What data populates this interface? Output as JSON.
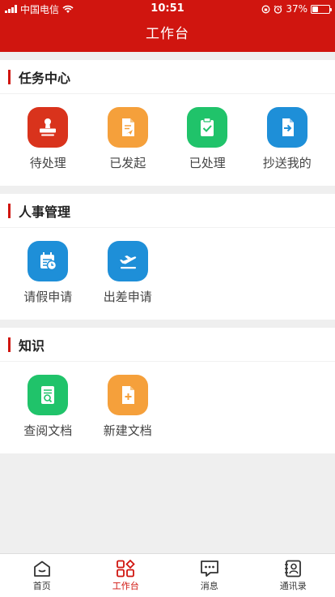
{
  "status_bar": {
    "carrier": "中国电信",
    "time": "10:51",
    "battery": "37%",
    "battery_level": 0.37,
    "icons": [
      "signal-icon",
      "wifi-icon",
      "rotation-lock-icon",
      "alarm-icon",
      "battery-icon"
    ]
  },
  "header": {
    "title": "工作台",
    "bg_color": "#d0150f"
  },
  "sections": [
    {
      "title": "任务中心",
      "items": [
        {
          "label": "待处理",
          "icon": "stamp-icon",
          "color": "#d9331c"
        },
        {
          "label": "已发起",
          "icon": "document-send-icon",
          "color": "#f5a03b"
        },
        {
          "label": "已处理",
          "icon": "clipboard-check-icon",
          "color": "#20c36a"
        },
        {
          "label": "抄送我的",
          "icon": "file-forward-icon",
          "color": "#1e8fd8"
        }
      ]
    },
    {
      "title": "人事管理",
      "items": [
        {
          "label": "请假申请",
          "icon": "calendar-clock-icon",
          "color": "#1e8fd8"
        },
        {
          "label": "出差申请",
          "icon": "airplane-icon",
          "color": "#1e8fd8"
        }
      ]
    },
    {
      "title": "知识",
      "items": [
        {
          "label": "查阅文档",
          "icon": "document-search-icon",
          "color": "#20c36a"
        },
        {
          "label": "新建文档",
          "icon": "document-add-icon",
          "color": "#f5a03b"
        }
      ]
    }
  ],
  "tabbar": {
    "active_index": 1,
    "active_color": "#d0150f",
    "items": [
      {
        "label": "首页",
        "icon": "home-icon"
      },
      {
        "label": "工作台",
        "icon": "workbench-icon"
      },
      {
        "label": "消息",
        "icon": "message-icon"
      },
      {
        "label": "通讯录",
        "icon": "contacts-icon"
      }
    ]
  }
}
